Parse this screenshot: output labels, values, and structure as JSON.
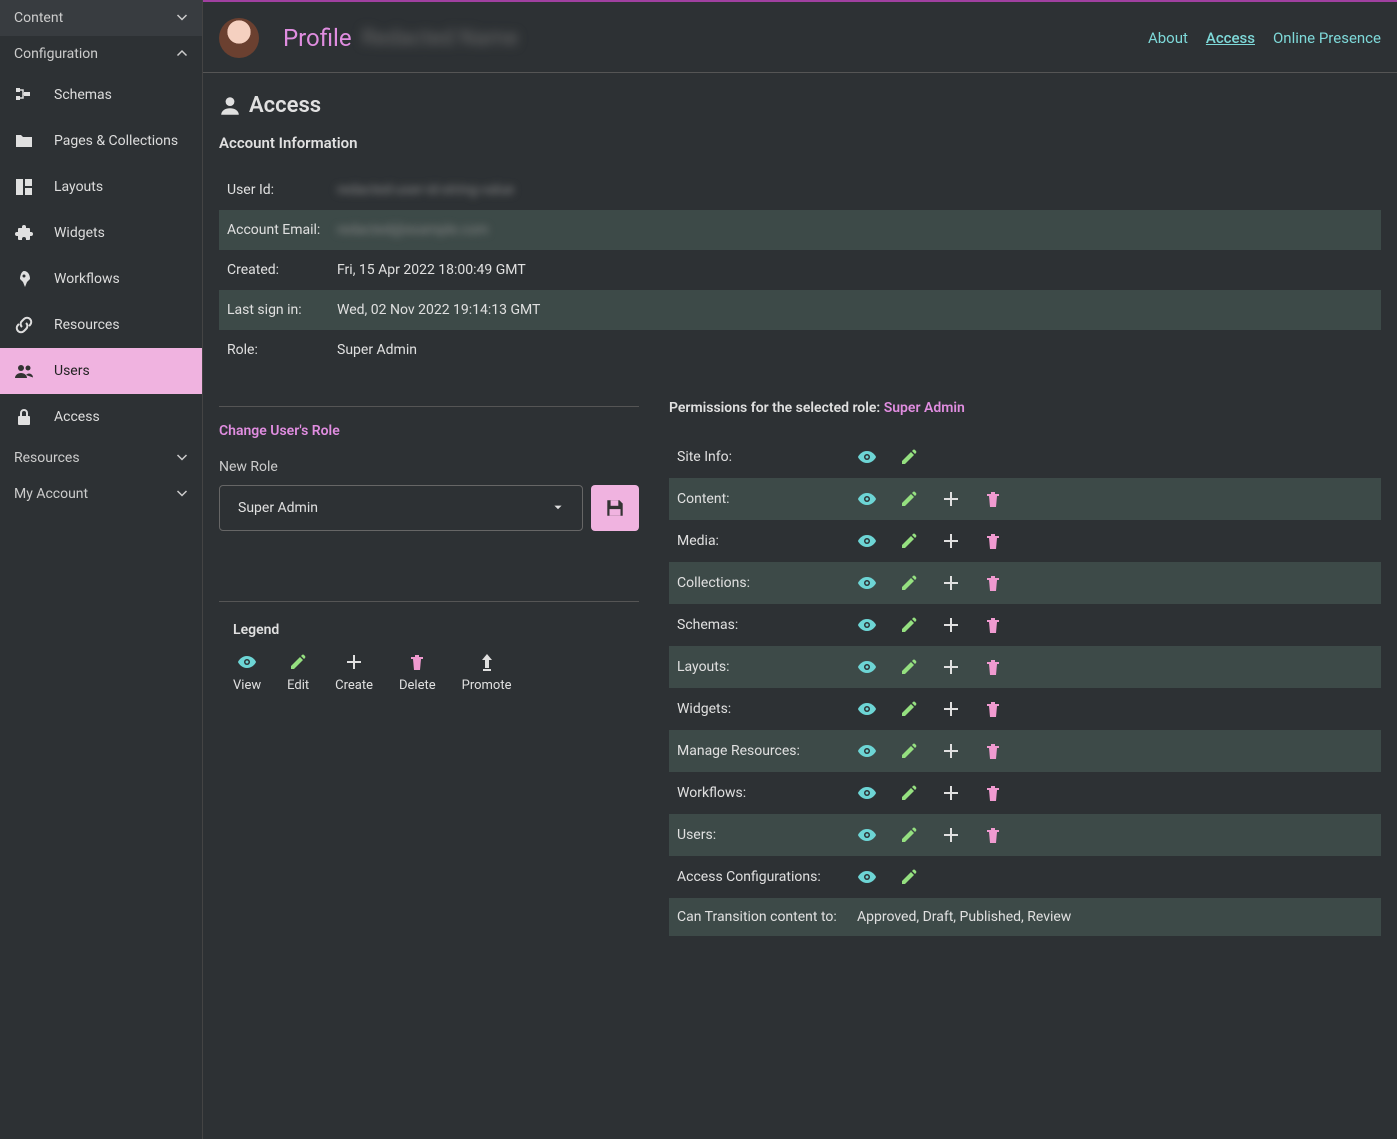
{
  "sidebar": {
    "groups": [
      {
        "label": "Content",
        "expanded": false
      },
      {
        "label": "Configuration",
        "expanded": true,
        "items": [
          {
            "label": "Schemas",
            "icon": "schema-icon"
          },
          {
            "label": "Pages & Collections",
            "icon": "folder-icon"
          },
          {
            "label": "Layouts",
            "icon": "layout-icon"
          },
          {
            "label": "Widgets",
            "icon": "puzzle-icon"
          },
          {
            "label": "Workflows",
            "icon": "rocket-icon"
          },
          {
            "label": "Resources",
            "icon": "link-icon"
          },
          {
            "label": "Users",
            "icon": "users-icon",
            "active": true
          },
          {
            "label": "Access",
            "icon": "lock-icon"
          }
        ]
      },
      {
        "label": "Resources",
        "expanded": false
      },
      {
        "label": "My Account",
        "expanded": false
      }
    ]
  },
  "header": {
    "title": "Profile",
    "name": "Redacted Name",
    "tabs": [
      {
        "label": "About",
        "active": false
      },
      {
        "label": "Access",
        "active": true
      },
      {
        "label": "Online Presence",
        "active": false
      }
    ]
  },
  "section": {
    "title": "Access"
  },
  "account_info": {
    "heading": "Account Information",
    "rows": [
      {
        "label": "User Id:",
        "value": "redacted-user-id-string-value",
        "blurred": true
      },
      {
        "label": "Account Email:",
        "value": "redacted@example.com",
        "blurred": true
      },
      {
        "label": "Created:",
        "value": "Fri, 15 Apr 2022 18:00:49 GMT"
      },
      {
        "label": "Last sign in:",
        "value": "Wed, 02 Nov 2022 19:14:13 GMT"
      },
      {
        "label": "Role:",
        "value": "Super Admin"
      }
    ]
  },
  "change_role": {
    "heading": "Change User's Role",
    "field_label": "New Role",
    "selected": "Super Admin"
  },
  "legend": {
    "heading": "Legend",
    "items": [
      {
        "label": "View",
        "icon": "view"
      },
      {
        "label": "Edit",
        "icon": "edit"
      },
      {
        "label": "Create",
        "icon": "create"
      },
      {
        "label": "Delete",
        "icon": "delete"
      },
      {
        "label": "Promote",
        "icon": "promote"
      }
    ]
  },
  "permissions": {
    "heading_prefix": "Permissions for the selected role: ",
    "role": "Super Admin",
    "rows": [
      {
        "label": "Site Info:",
        "perms": [
          "view",
          "edit"
        ]
      },
      {
        "label": "Content:",
        "perms": [
          "view",
          "edit",
          "create",
          "delete"
        ]
      },
      {
        "label": "Media:",
        "perms": [
          "view",
          "edit",
          "create",
          "delete"
        ]
      },
      {
        "label": "Collections:",
        "perms": [
          "view",
          "edit",
          "create",
          "delete"
        ]
      },
      {
        "label": "Schemas:",
        "perms": [
          "view",
          "edit",
          "create",
          "delete"
        ]
      },
      {
        "label": "Layouts:",
        "perms": [
          "view",
          "edit",
          "create",
          "delete"
        ]
      },
      {
        "label": "Widgets:",
        "perms": [
          "view",
          "edit",
          "create",
          "delete"
        ]
      },
      {
        "label": "Manage Resources:",
        "perms": [
          "view",
          "edit",
          "create",
          "delete"
        ]
      },
      {
        "label": "Workflows:",
        "perms": [
          "view",
          "edit",
          "create",
          "delete"
        ]
      },
      {
        "label": "Users:",
        "perms": [
          "view",
          "edit",
          "create",
          "delete"
        ]
      },
      {
        "label": "Access Configurations:",
        "perms": [
          "view",
          "edit"
        ]
      }
    ],
    "transition": {
      "label": "Can Transition content to:",
      "value": "Approved, Draft, Published, Review"
    }
  }
}
